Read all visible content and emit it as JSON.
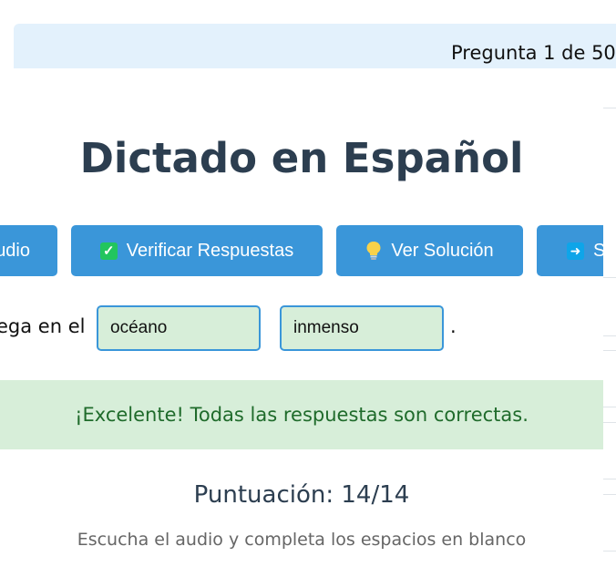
{
  "header": {
    "progress": "Pregunta 1 de 50"
  },
  "main": {
    "title": "Dictado en Español",
    "buttons": {
      "audio_label": "udio",
      "verify_label": "Verificar Respuestas",
      "solution_label": "Ver Solución",
      "next_label": "S"
    },
    "icons": {
      "verify": "check-icon",
      "solution": "lightbulb-icon",
      "next": "arrow-right-icon"
    },
    "sentence": {
      "prefix": "ega en el",
      "answers": [
        "océano",
        "inmenso"
      ],
      "end": "."
    },
    "feedback": "¡Excelente! Todas las respuestas son correctas.",
    "score": "Puntuación: 14/14",
    "instructions": "Escucha el audio y completa los espacios en blanco"
  },
  "colors": {
    "primary_button": "#3a96d9",
    "title": "#2c3e50",
    "success_bg": "#d7eed9",
    "success_text": "#1f6b2b",
    "header_strip": "#e3f1fc"
  }
}
